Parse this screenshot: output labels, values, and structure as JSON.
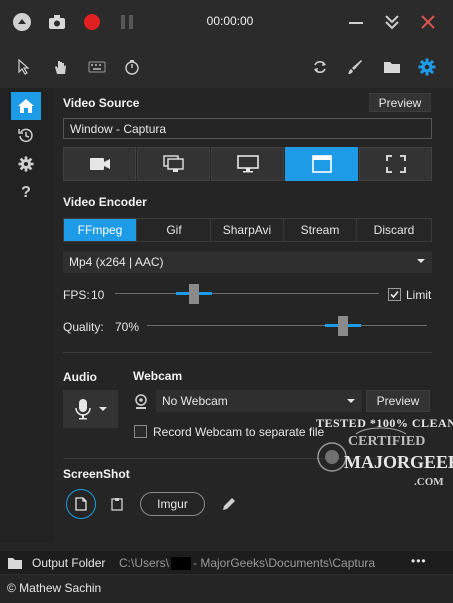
{
  "titlebar": {
    "timer": "00:00:00",
    "icons": [
      "minimize-circle-icon",
      "camera-icon",
      "record-icon",
      "pause-icon",
      "collapse-icon",
      "chevron-double-down-icon",
      "close-icon"
    ]
  },
  "toolbar": {
    "icons": [
      "cursor-icon",
      "hand-icon",
      "keyboard-icon",
      "timer-icon",
      "refresh-icon",
      "brush-icon",
      "folder-icon",
      "settings-icon"
    ]
  },
  "sidebar": {
    "items": [
      "home-icon",
      "history-icon",
      "settings-icon",
      "help-icon"
    ],
    "help_label": "?"
  },
  "video_source": {
    "title": "Video Source",
    "preview_label": "Preview",
    "value": "Window  -  Captura",
    "sources": [
      "camera",
      "screen-region",
      "monitor",
      "window",
      "fullscreen"
    ],
    "active_source": "window"
  },
  "video_encoder": {
    "title": "Video Encoder",
    "tabs": [
      "FFmpeg",
      "Gif",
      "SharpAvi",
      "Stream",
      "Discard"
    ],
    "active_tab": "FFmpeg",
    "codec": "Mp4 (x264 | AAC)"
  },
  "fps": {
    "label": "FPS:",
    "value": "10",
    "level": 0.3,
    "limit_label": "Limit",
    "limit_checked": true
  },
  "quality": {
    "label": "Quality:",
    "value": "70%",
    "level": 0.7
  },
  "audio": {
    "title": "Audio"
  },
  "webcam": {
    "title": "Webcam",
    "selected": "No Webcam",
    "preview_label": "Preview",
    "record_separate_label": "Record Webcam to separate file",
    "record_separate_checked": false
  },
  "screenshot": {
    "title": "ScreenShot",
    "imgur_label": "Imgur"
  },
  "statusbar": {
    "output_label": "Output Folder",
    "path_prefix": "C:\\Users\\",
    "path_suffix": " - MajorGeeks\\Documents\\Captura",
    "more_label": "•••"
  },
  "footer": {
    "author": "© Mathew Sachin"
  },
  "watermark": {
    "line1": "TESTED *100% CLEAN",
    "line2": "CERTIFIED",
    "line3": "MAJORGEEKS",
    "line4": ".COM"
  },
  "colors": {
    "accent": "#1e9be6",
    "record": "#e02020",
    "close": "#d9534f"
  }
}
